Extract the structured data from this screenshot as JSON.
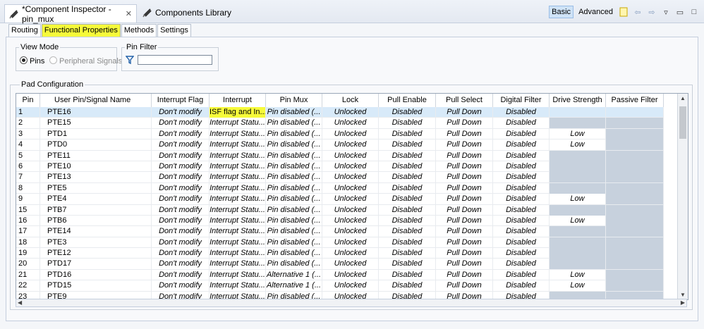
{
  "editor_tabs": [
    {
      "label": "*Component Inspector - pin_mux",
      "icon": "component-icon"
    },
    {
      "label": "Components Library",
      "icon": "library-icon"
    }
  ],
  "toolbar": {
    "basic_label": "Basic",
    "advanced_label": "Advanced"
  },
  "sub_tabs": [
    "Routing",
    "Functional Properties",
    "Methods",
    "Settings"
  ],
  "view_mode": {
    "title": "View Mode",
    "option_pins": "Pins",
    "option_signals": "Peripheral Signals",
    "selected": "Pins"
  },
  "pin_filter": {
    "title": "Pin Filter",
    "value": ""
  },
  "pad_configuration": {
    "title": "Pad Configuration"
  },
  "table": {
    "columns": [
      "Pin",
      "User Pin/Signal Name",
      "Interrupt Flag",
      "Interrupt",
      "Pin Mux",
      "Lock",
      "Pull Enable",
      "Pull Select",
      "Digital Filter",
      "Drive Strength",
      "Passive Filter"
    ],
    "rows": [
      {
        "pin": "1",
        "name": "PTE16",
        "flag": "Don't modify",
        "interrupt": "ISF flag and In...",
        "mux": "Pin disabled (...",
        "lock": "Unlocked",
        "pe": "Disabled",
        "ps": "Pull Down",
        "df": "Disabled",
        "ds": "",
        "pf": "",
        "selected": true
      },
      {
        "pin": "2",
        "name": "PTE15",
        "flag": "Don't modify",
        "interrupt": "Interrupt Statu...",
        "mux": "Pin disabled (...",
        "lock": "Unlocked",
        "pe": "Disabled",
        "ps": "Pull Down",
        "df": "Disabled",
        "ds": "",
        "pf": ""
      },
      {
        "pin": "3",
        "name": "PTD1",
        "flag": "Don't modify",
        "interrupt": "Interrupt Statu...",
        "mux": "Pin disabled (...",
        "lock": "Unlocked",
        "pe": "Disabled",
        "ps": "Pull Down",
        "df": "Disabled",
        "ds": "Low",
        "pf": ""
      },
      {
        "pin": "4",
        "name": "PTD0",
        "flag": "Don't modify",
        "interrupt": "Interrupt Statu...",
        "mux": "Pin disabled (...",
        "lock": "Unlocked",
        "pe": "Disabled",
        "ps": "Pull Down",
        "df": "Disabled",
        "ds": "Low",
        "pf": ""
      },
      {
        "pin": "5",
        "name": "PTE11",
        "flag": "Don't modify",
        "interrupt": "Interrupt Statu...",
        "mux": "Pin disabled (...",
        "lock": "Unlocked",
        "pe": "Disabled",
        "ps": "Pull Down",
        "df": "Disabled",
        "ds": "",
        "pf": ""
      },
      {
        "pin": "6",
        "name": "PTE10",
        "flag": "Don't modify",
        "interrupt": "Interrupt Statu...",
        "mux": "Pin disabled (...",
        "lock": "Unlocked",
        "pe": "Disabled",
        "ps": "Pull Down",
        "df": "Disabled",
        "ds": "",
        "pf": ""
      },
      {
        "pin": "7",
        "name": "PTE13",
        "flag": "Don't modify",
        "interrupt": "Interrupt Statu...",
        "mux": "Pin disabled (...",
        "lock": "Unlocked",
        "pe": "Disabled",
        "ps": "Pull Down",
        "df": "Disabled",
        "ds": "",
        "pf": ""
      },
      {
        "pin": "8",
        "name": "PTE5",
        "flag": "Don't modify",
        "interrupt": "Interrupt Statu...",
        "mux": "Pin disabled (...",
        "lock": "Unlocked",
        "pe": "Disabled",
        "ps": "Pull Down",
        "df": "Disabled",
        "ds": "",
        "pf": ""
      },
      {
        "pin": "9",
        "name": "PTE4",
        "flag": "Don't modify",
        "interrupt": "Interrupt Statu...",
        "mux": "Pin disabled (...",
        "lock": "Unlocked",
        "pe": "Disabled",
        "ps": "Pull Down",
        "df": "Disabled",
        "ds": "Low",
        "pf": ""
      },
      {
        "pin": "15",
        "name": "PTB7",
        "flag": "Don't modify",
        "interrupt": "Interrupt Statu...",
        "mux": "Pin disabled (...",
        "lock": "Unlocked",
        "pe": "Disabled",
        "ps": "Pull Down",
        "df": "Disabled",
        "ds": "",
        "pf": ""
      },
      {
        "pin": "16",
        "name": "PTB6",
        "flag": "Don't modify",
        "interrupt": "Interrupt Statu...",
        "mux": "Pin disabled (...",
        "lock": "Unlocked",
        "pe": "Disabled",
        "ps": "Pull Down",
        "df": "Disabled",
        "ds": "Low",
        "pf": ""
      },
      {
        "pin": "17",
        "name": "PTE14",
        "flag": "Don't modify",
        "interrupt": "Interrupt Statu...",
        "mux": "Pin disabled (...",
        "lock": "Unlocked",
        "pe": "Disabled",
        "ps": "Pull Down",
        "df": "Disabled",
        "ds": "",
        "pf": ""
      },
      {
        "pin": "18",
        "name": "PTE3",
        "flag": "Don't modify",
        "interrupt": "Interrupt Statu...",
        "mux": "Pin disabled (...",
        "lock": "Unlocked",
        "pe": "Disabled",
        "ps": "Pull Down",
        "df": "Disabled",
        "ds": "",
        "pf": ""
      },
      {
        "pin": "19",
        "name": "PTE12",
        "flag": "Don't modify",
        "interrupt": "Interrupt Statu...",
        "mux": "Pin disabled (...",
        "lock": "Unlocked",
        "pe": "Disabled",
        "ps": "Pull Down",
        "df": "Disabled",
        "ds": "",
        "pf": ""
      },
      {
        "pin": "20",
        "name": "PTD17",
        "flag": "Don't modify",
        "interrupt": "Interrupt Statu...",
        "mux": "Pin disabled (...",
        "lock": "Unlocked",
        "pe": "Disabled",
        "ps": "Pull Down",
        "df": "Disabled",
        "ds": "",
        "pf": ""
      },
      {
        "pin": "21",
        "name": "PTD16",
        "flag": "Don't modify",
        "interrupt": "Interrupt Statu...",
        "mux": "Alternative 1 (...",
        "lock": "Unlocked",
        "pe": "Disabled",
        "ps": "Pull Down",
        "df": "Disabled",
        "ds": "Low",
        "pf": ""
      },
      {
        "pin": "22",
        "name": "PTD15",
        "flag": "Don't modify",
        "interrupt": "Interrupt Statu...",
        "mux": "Alternative 1 (...",
        "lock": "Unlocked",
        "pe": "Disabled",
        "ps": "Pull Down",
        "df": "Disabled",
        "ds": "Low",
        "pf": ""
      },
      {
        "pin": "23",
        "name": "PTE9",
        "flag": "Don't modify",
        "interrupt": "Interrupt Statu...",
        "mux": "Pin disabled (...",
        "lock": "Unlocked",
        "pe": "Disabled",
        "ps": "Pull Down",
        "df": "Disabled",
        "ds": "",
        "pf": ""
      }
    ]
  },
  "colors": {
    "highlight": "#f6fa3a",
    "selected_row": "#d8eaf9",
    "disabled_cell": "#c7d1dd"
  }
}
